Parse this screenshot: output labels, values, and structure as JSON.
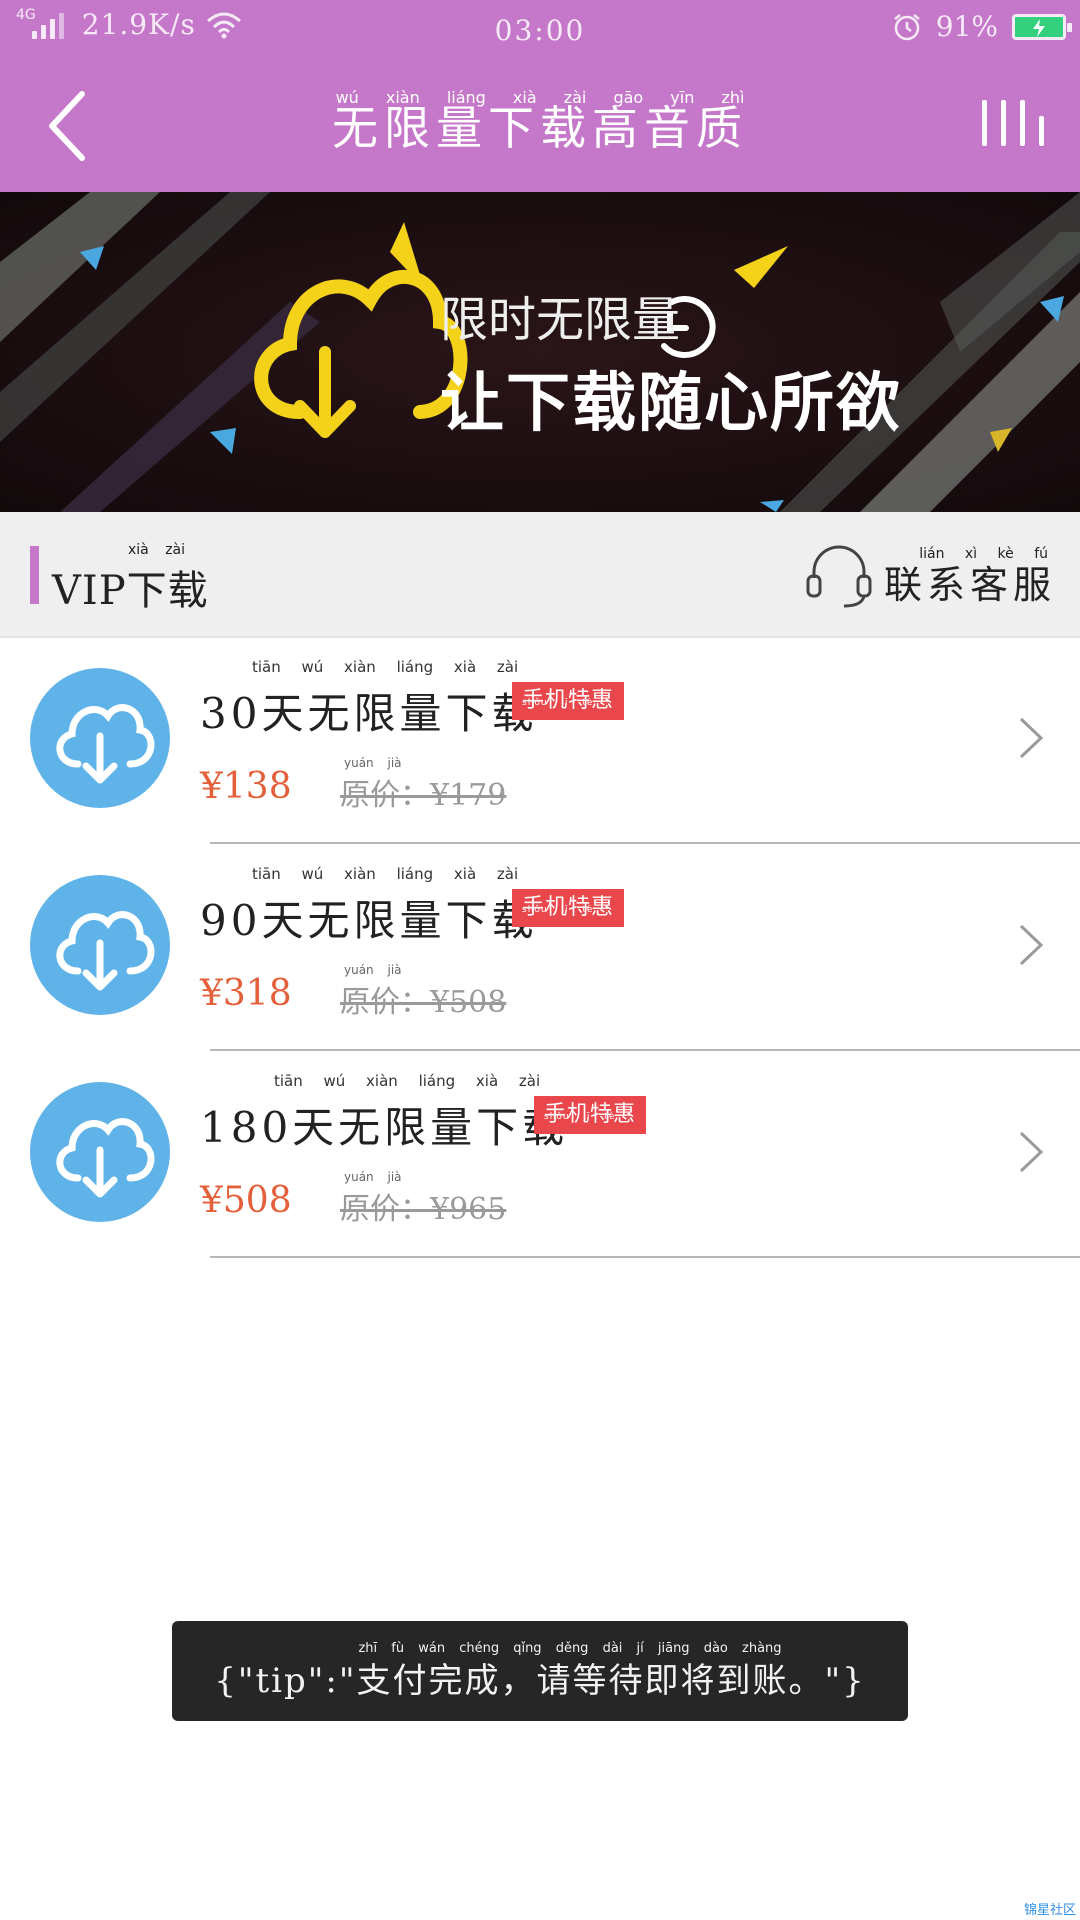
{
  "status_bar": {
    "network": "4G",
    "speed": "21.9K/s",
    "time": "03:00",
    "battery": "91%",
    "icons": [
      "signal-icon",
      "wifi-icon",
      "alarm-icon",
      "battery-charging-icon"
    ]
  },
  "nav": {
    "title": "无限量下载高音质",
    "title_pinyin": "wú xiàn liáng xià zài gāo yīn zhì",
    "back_icon": "chevron-left-icon",
    "menu_icon": "equalizer-bars-icon"
  },
  "banner": {
    "line1": "限时无限量",
    "line2": "让下载随心所欲",
    "colors": {
      "cloud": "#f5d21a",
      "accent_blue": "#4aa7e0",
      "text": "#ffffff"
    }
  },
  "section": {
    "title": "VIP下载",
    "title_pinyin": "xià zài",
    "service_label": "联系客服",
    "service_pinyin": "lián xì kè fú",
    "service_icon": "headset-icon"
  },
  "products": [
    {
      "title": "30天无限量下载",
      "title_pinyin": "tiān wú xiàn liáng xià zài",
      "badge": "手机特惠",
      "badge_pinyin": "shǒu jī tè huì",
      "price": "¥138",
      "original_label": "原价：¥179",
      "original_pinyin": "yuán jià"
    },
    {
      "title": "90天无限量下载",
      "title_pinyin": "tiān wú xiàn liáng xià zài",
      "badge": "手机特惠",
      "badge_pinyin": "shǒu jī tè huì",
      "price": "¥318",
      "original_label": "原价：¥508",
      "original_pinyin": "yuán jià"
    },
    {
      "title": "180天无限量下载",
      "title_pinyin": "tiān wú xiàn liáng xià zài",
      "badge": "手机特惠",
      "badge_pinyin": "shǒu jī tè huì",
      "price": "¥508",
      "original_label": "原价：¥965",
      "original_pinyin": "yuán jià"
    }
  ],
  "toast": {
    "text": "{\"tip\":\"支付完成，请等待即将到账。\"}",
    "pinyin": "zhī fù wán chéng qǐng děng dài jí jiāng dào zhàng"
  },
  "watermark": "锦星社区",
  "colors": {
    "header": "#c578c9",
    "price": "#e4603a",
    "badge": "#e9474b",
    "icon_circle": "#5fb3e8",
    "toast_bg": "#262626"
  }
}
